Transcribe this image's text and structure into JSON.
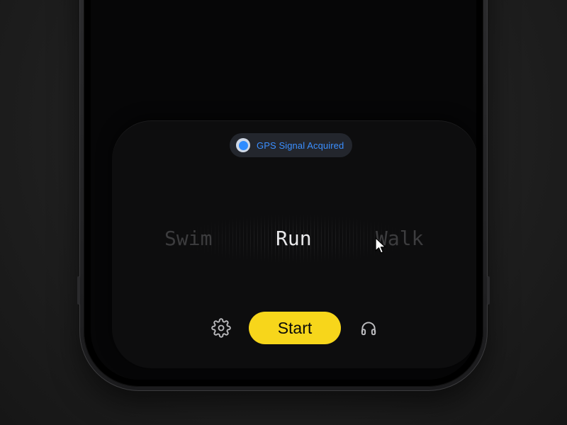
{
  "gps": {
    "status_text": "GPS Signal Acquired",
    "dot_color": "#2f8cff"
  },
  "activity_picker": {
    "options": [
      "Swim",
      "Run",
      "Walk"
    ],
    "selected": "Run"
  },
  "controls": {
    "settings_icon": "gear-icon",
    "start_label": "Start",
    "audio_icon": "headphones-icon"
  },
  "colors": {
    "accent": "#f7d61b",
    "gps_blue": "#3b8fff",
    "background": "#060607"
  }
}
